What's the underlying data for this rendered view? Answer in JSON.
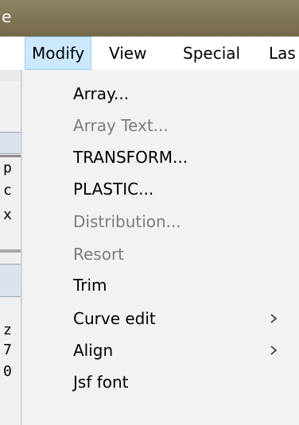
{
  "window": {
    "title_fragment": "e"
  },
  "menubar": {
    "items": [
      {
        "label": "Modify",
        "active": true
      },
      {
        "label": "View",
        "active": false
      },
      {
        "label": "Special",
        "active": false
      },
      {
        "label": "Las",
        "active": false
      }
    ]
  },
  "left_strip": {
    "fragments": [
      "p",
      "c",
      "x",
      "z",
      "7",
      "0"
    ]
  },
  "dropdown": {
    "items": [
      {
        "label": "Array...",
        "enabled": true,
        "submenu": false
      },
      {
        "label": "Array Text...",
        "enabled": false,
        "submenu": false
      },
      {
        "label": "TRANSFORM...",
        "enabled": true,
        "submenu": false
      },
      {
        "label": "PLASTIC...",
        "enabled": true,
        "submenu": false
      },
      {
        "label": "Distribution...",
        "enabled": false,
        "submenu": false
      },
      {
        "label": "Resort",
        "enabled": false,
        "submenu": false
      },
      {
        "label": "Trim",
        "enabled": true,
        "submenu": false
      },
      {
        "label": "Curve edit",
        "enabled": true,
        "submenu": true,
        "submenu_icon": "chevron-right-icon"
      },
      {
        "label": "Align",
        "enabled": true,
        "submenu": true,
        "submenu_icon": "chevron-right-icon"
      },
      {
        "label": "Jsf font",
        "enabled": true,
        "submenu": false
      }
    ]
  },
  "colors": {
    "titlebar": "#7f7456",
    "menu_highlight": "#cce8ff",
    "menu_highlight_border": "#99d1ff",
    "dropdown_bg": "#f2f2f2",
    "disabled_text": "#7d7d7d"
  }
}
